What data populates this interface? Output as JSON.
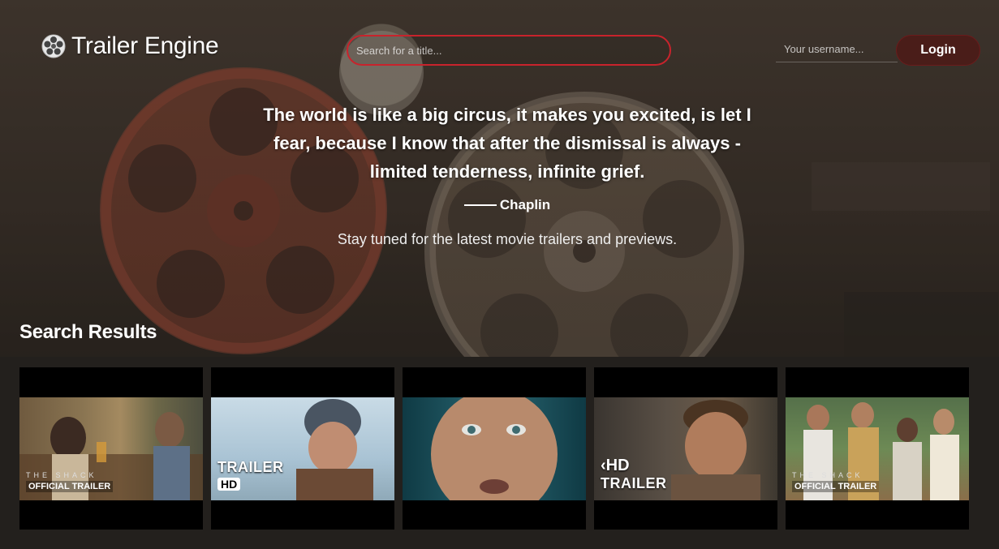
{
  "header": {
    "app_title": "Trailer Engine",
    "search": {
      "placeholder": "Search for a title...",
      "value": ""
    },
    "username": {
      "placeholder": "Your username...",
      "value": ""
    },
    "login_label": "Login"
  },
  "hero": {
    "quote": "The world is like a big circus, it makes you excited, is let I fear, because I know that after the dismissal is always - limited tenderness, infinite grief.",
    "author": "Chaplin",
    "tagline": "Stay tuned for the latest movie trailers and previews."
  },
  "results": {
    "title": "Search Results",
    "items": [
      {
        "overlay_top": "THE SHACK",
        "overlay_bottom": "OFFICIAL TRAILER"
      },
      {
        "overlay_top": "TRAILER",
        "overlay_bottom": "HD"
      },
      {
        "overlay_top": "",
        "overlay_bottom": ""
      },
      {
        "overlay_top": "HD",
        "overlay_bottom": "TRAILER"
      },
      {
        "overlay_top": "THE SHACK",
        "overlay_bottom": "OFFICIAL TRAILER"
      }
    ]
  },
  "colors": {
    "accent_red": "#c8232c",
    "login_bg": "#4a1d19",
    "page_bottom": "#23201d"
  },
  "icons": {
    "logo": "film-reel-icon"
  }
}
